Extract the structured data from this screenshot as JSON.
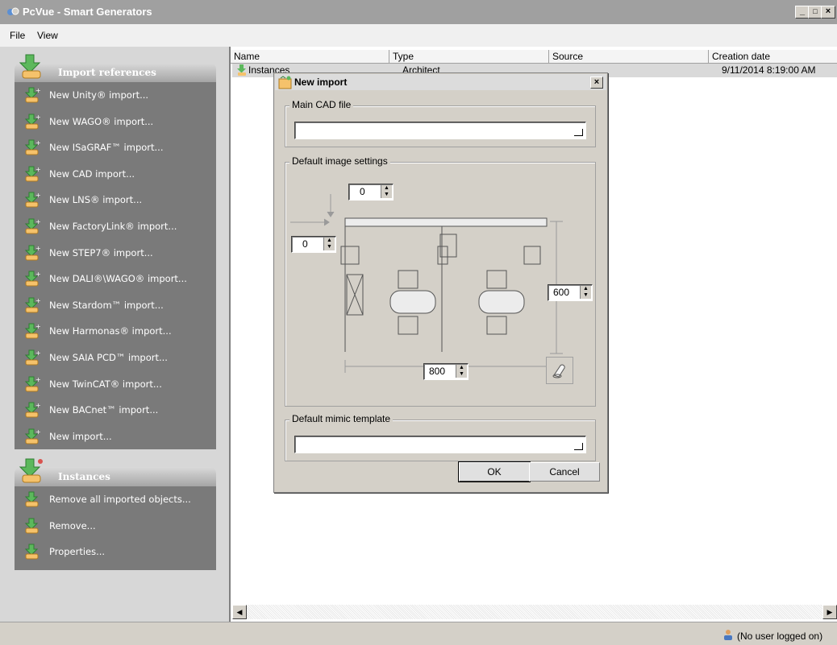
{
  "window": {
    "title": "PcVue - Smart Generators",
    "minimize": "_",
    "maximize": "□",
    "close": "×"
  },
  "menu": {
    "file": "File",
    "view": "View"
  },
  "sidebar": {
    "import_header": "Import references",
    "import_items": [
      {
        "label": "New Unity® import..."
      },
      {
        "label": "New WAGO® import..."
      },
      {
        "label": "New ISaGRAF™ import..."
      },
      {
        "label": "New CAD import..."
      },
      {
        "label": "New LNS® import..."
      },
      {
        "label": "New FactoryLink® import..."
      },
      {
        "label": "New STEP7® import..."
      },
      {
        "label": "New DALI®\\WAGO® import..."
      },
      {
        "label": "New Stardom™ import..."
      },
      {
        "label": "New Harmonas® import..."
      },
      {
        "label": "New SAIA PCD™ import..."
      },
      {
        "label": "New TwinCAT® import..."
      },
      {
        "label": "New BACnet™ import..."
      },
      {
        "label": "New import..."
      }
    ],
    "instances_header": "Instances",
    "instance_items": [
      {
        "label": "Remove all imported objects..."
      },
      {
        "label": "Remove..."
      },
      {
        "label": "Properties..."
      }
    ]
  },
  "list": {
    "columns": [
      "Name",
      "Type",
      "Source",
      "Creation date"
    ],
    "rows": [
      {
        "name": "Instances",
        "type": "Architect",
        "source": "",
        "date": "9/11/2014 8:19:00 AM"
      }
    ]
  },
  "dialog": {
    "title": "New import",
    "close": "×",
    "main_cad_label": "Main CAD file",
    "main_cad_value": "",
    "image_settings_label": "Default image settings",
    "top_offset": "0",
    "left_offset": "0",
    "height": "600",
    "width": "800",
    "mimic_label": "Default mimic template",
    "mimic_value": "",
    "ok": "OK",
    "cancel": "Cancel"
  },
  "status": {
    "user": "(No user logged on)"
  }
}
